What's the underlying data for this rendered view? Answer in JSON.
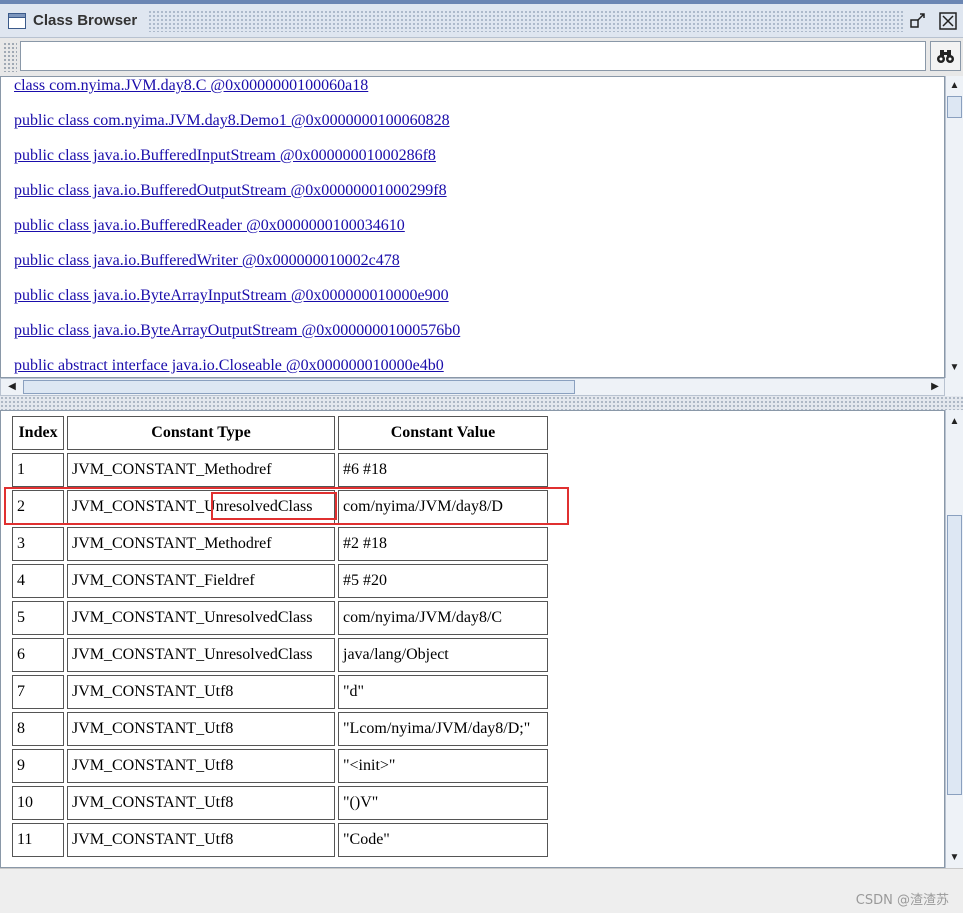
{
  "window": {
    "title": "Class Browser"
  },
  "search": {
    "value": "",
    "placeholder": ""
  },
  "class_list": [
    "class com.nyima.JVM.day8.C @0x0000000100060a18",
    "public class com.nyima.JVM.day8.Demo1 @0x0000000100060828",
    "public class java.io.BufferedInputStream @0x00000001000286f8",
    "public class java.io.BufferedOutputStream @0x00000001000299f8",
    "public class java.io.BufferedReader @0x0000000100034610",
    "public class java.io.BufferedWriter @0x000000010002c478",
    "public class java.io.ByteArrayInputStream @0x000000010000e900",
    "public class java.io.ByteArrayOutputStream @0x00000001000576b0",
    "public abstract interface java.io.Closeable @0x000000010000e4b0"
  ],
  "constant_pool": {
    "headers": [
      "Index",
      "Constant Type",
      "Constant Value"
    ],
    "rows": [
      [
        "1",
        "JVM_CONSTANT_Methodref",
        "#6 #18"
      ],
      [
        "2",
        "JVM_CONSTANT_UnresolvedClass",
        "com/nyima/JVM/day8/D"
      ],
      [
        "3",
        "JVM_CONSTANT_Methodref",
        "#2 #18"
      ],
      [
        "4",
        "JVM_CONSTANT_Fieldref",
        "#5 #20"
      ],
      [
        "5",
        "JVM_CONSTANT_UnresolvedClass",
        "com/nyima/JVM/day8/C"
      ],
      [
        "6",
        "JVM_CONSTANT_UnresolvedClass",
        "java/lang/Object"
      ],
      [
        "7",
        "JVM_CONSTANT_Utf8",
        "\"d\""
      ],
      [
        "8",
        "JVM_CONSTANT_Utf8",
        "\"Lcom/nyima/JVM/day8/D;\""
      ],
      [
        "9",
        "JVM_CONSTANT_Utf8",
        "\"<init>\""
      ],
      [
        "10",
        "JVM_CONSTANT_Utf8",
        "\"()V\""
      ],
      [
        "11",
        "JVM_CONSTANT_Utf8",
        "\"Code\""
      ]
    ]
  },
  "highlight": {
    "color": "#e03030",
    "row_index": "2",
    "word": "UnresolvedClass"
  },
  "watermark": "CSDN @渣渣苏",
  "icons": [
    "window-icon",
    "restore-icon",
    "close-icon",
    "binoculars-icon",
    "scroll-up-icon",
    "scroll-down-icon",
    "scroll-left-icon",
    "scroll-right-icon"
  ]
}
